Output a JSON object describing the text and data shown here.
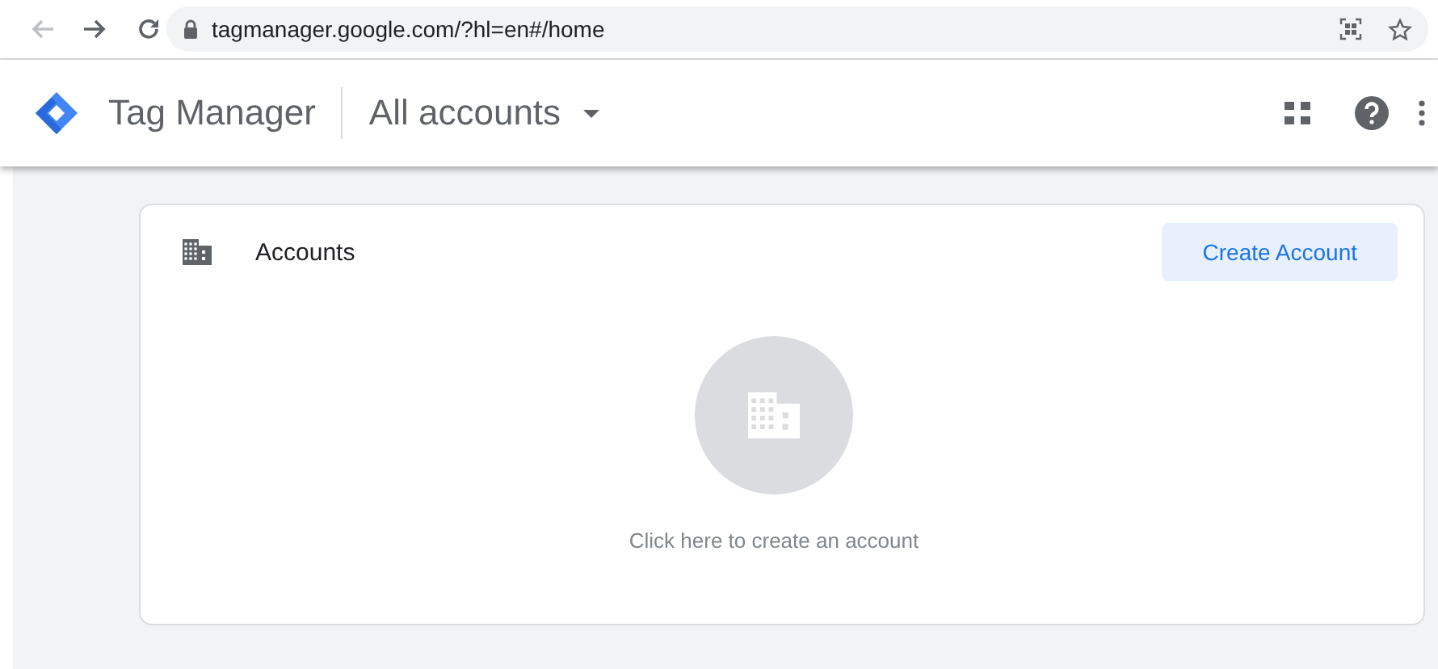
{
  "browser": {
    "url": "tagmanager.google.com/?hl=en#/home"
  },
  "app_bar": {
    "title": "Tag Manager",
    "account_picker": "All accounts"
  },
  "accounts_card": {
    "title": "Accounts",
    "create_button": "Create Account",
    "empty_message": "Click here to create an account"
  }
}
